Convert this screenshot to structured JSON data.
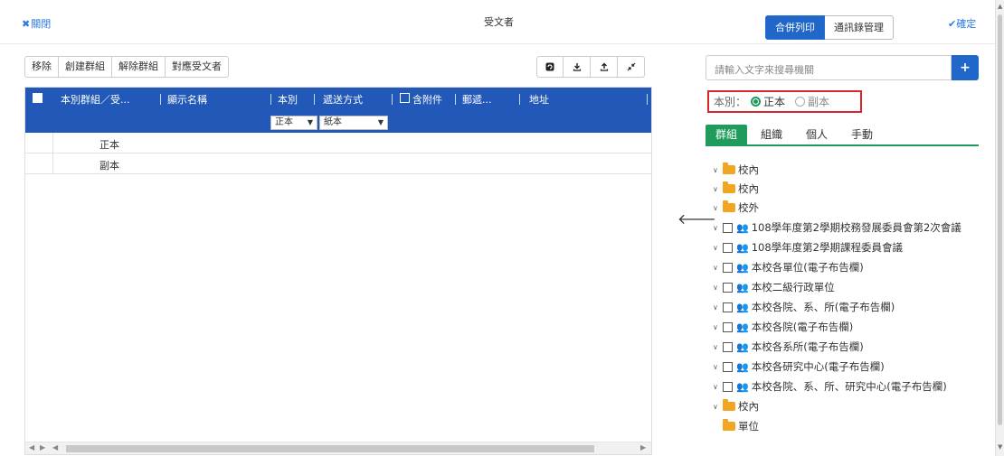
{
  "header": {
    "close_label": "關閉",
    "title": "受文者",
    "tabs": [
      "合併列印",
      "通訊錄管理"
    ],
    "confirm_label": "確定"
  },
  "toolbar": {
    "buttons": [
      "移除",
      "創建群組",
      "解除群組",
      "對應受文者"
    ],
    "icons": [
      "refresh-icon",
      "download-icon",
      "upload-icon",
      "collapse-icon"
    ]
  },
  "grid": {
    "columns": [
      "本別群組／受...",
      "顯示名稱",
      "本別",
      "遞送方式",
      "含附件",
      "郵遞...",
      "地址"
    ],
    "filters": {
      "copy_type": "正本",
      "delivery": "紙本"
    },
    "rows": [
      "正本",
      "副本"
    ]
  },
  "search": {
    "placeholder": "請輸入文字來搜尋機關"
  },
  "copy_type": {
    "label": "本別：",
    "options": [
      "正本",
      "副本"
    ],
    "selected": "正本"
  },
  "panel_tabs": [
    "群組",
    "組織",
    "個人",
    "手動"
  ],
  "tree": [
    {
      "label": "校內",
      "type": "folder"
    },
    {
      "label": "校內",
      "type": "folder"
    },
    {
      "label": "校外",
      "type": "folder"
    },
    {
      "label": "108學年度第2學期校務發展委員會第2次會議",
      "type": "group"
    },
    {
      "label": "108學年度第2學期課程委員會議",
      "type": "group"
    },
    {
      "label": "本校各單位(電子布告欄)",
      "type": "group"
    },
    {
      "label": "本校二級行政單位",
      "type": "group"
    },
    {
      "label": "本校各院、系、所(電子布告欄)",
      "type": "group"
    },
    {
      "label": "本校各院(電子布告欄)",
      "type": "group"
    },
    {
      "label": "本校各系所(電子布告欄)",
      "type": "group"
    },
    {
      "label": "本校各研究中心(電子布告欄)",
      "type": "group"
    },
    {
      "label": "本校各院、系、所、研究中心(電子布告欄)",
      "type": "group"
    },
    {
      "label": "校內",
      "type": "folder"
    },
    {
      "label": "單位",
      "type": "folder-leaf"
    }
  ],
  "colors": {
    "primary": "#2166c9",
    "header_bg": "#2258b8",
    "accent_green": "#1f9b5b",
    "highlight_red": "#d9262c"
  }
}
